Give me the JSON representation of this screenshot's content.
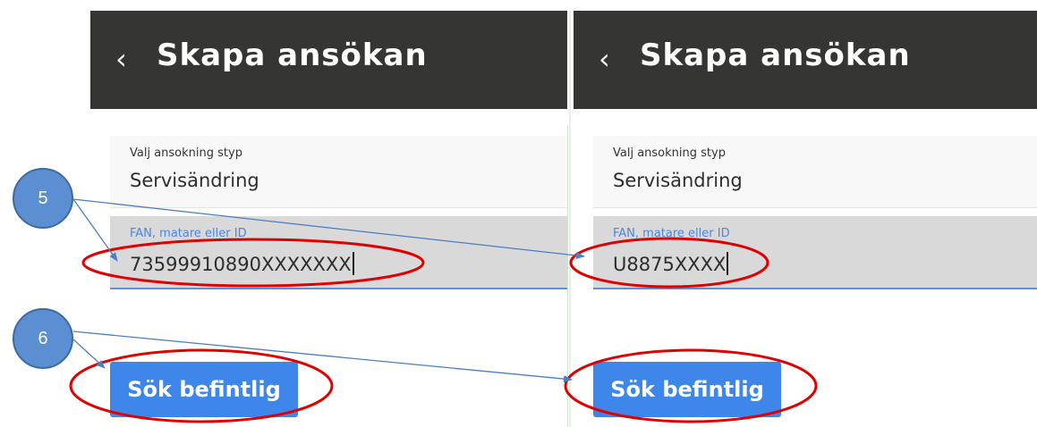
{
  "left_panel": {
    "back_icon": "‹",
    "title": "Skapa ansökan",
    "select_label": "Valj ansokning styp",
    "select_value": "Servisändring",
    "input_label": "FAN, matare eller ID",
    "input_value": "73599910890XXXXXXX",
    "button_label": "Sök befintlig"
  },
  "right_panel": {
    "back_icon": "‹",
    "title": "Skapa ansökan",
    "select_label": "Valj ansokning styp",
    "select_value": "Servisändring",
    "input_label": "FAN, matare eller ID",
    "input_value": "U8875XXXX",
    "button_label": "Sök befintlig"
  },
  "annotations": {
    "marker_5": "5",
    "marker_6": "6"
  },
  "colors": {
    "header_bg": "#353533",
    "button_bg": "#3f86ea",
    "marker_bg": "#5b8fd1",
    "highlight_ellipse": "#e00000",
    "arrow": "#4a7fc0"
  },
  "icons": {
    "back": "chevron-left-icon"
  }
}
